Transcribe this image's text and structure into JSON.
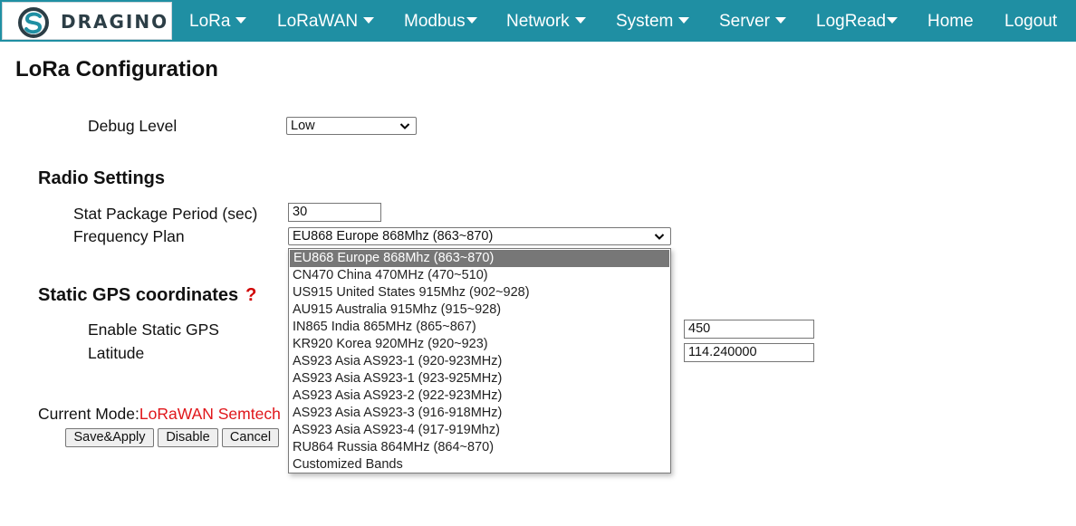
{
  "nav": {
    "logo_text": "DRAGINO",
    "items": [
      {
        "label": "LoRa",
        "has_caret": true
      },
      {
        "label": "LoRaWAN",
        "has_caret": true
      },
      {
        "label": "Modbus",
        "has_caret": true
      },
      {
        "label": "Network",
        "has_caret": true
      },
      {
        "label": "System",
        "has_caret": true
      },
      {
        "label": "Server",
        "has_caret": true
      },
      {
        "label": "LogRead",
        "has_caret": true
      },
      {
        "label": "Home",
        "has_caret": false
      },
      {
        "label": "Logout",
        "has_caret": false
      }
    ]
  },
  "page": {
    "title": "LoRa Configuration",
    "debug_level_label": "Debug Level",
    "debug_level_value": "Low",
    "radio_section": "Radio Settings",
    "stat_period_label": "Stat Package Period (sec)",
    "stat_period_value": "30",
    "freq_plan_label": "Frequency Plan",
    "freq_plan_value": "EU868 Europe 868Mhz (863~870)",
    "gps_section": "Static GPS coordinates",
    "gps_help": "?",
    "enable_gps_label": "Enable Static GPS",
    "latitude_label": "Latitude",
    "altitude_value": "450",
    "longitude_value": "114.240000",
    "mode_label": "Current Mode:",
    "mode_value": "LoRaWAN Semtech",
    "buttons": {
      "save": "Save&Apply",
      "disable": "Disable",
      "cancel": "Cancel"
    }
  },
  "dropdown": {
    "options": [
      "EU868 Europe 868Mhz (863~870)",
      "CN470 China 470MHz (470~510)",
      "US915 United States 915Mhz (902~928)",
      "AU915 Australia 915Mhz (915~928)",
      "IN865 India 865MHz (865~867)",
      "KR920 Korea 920MHz (920~923)",
      "AS923 Asia AS923-1 (920-923MHz)",
      "AS923 Asia AS923-1 (923-925MHz)",
      "AS923 Asia AS923-2 (922-923MHz)",
      "AS923 Asia AS923-3 (916-918MHz)",
      "AS923 Asia AS923-4 (917-919Mhz)",
      "RU864 Russia 864MHz (864~870)",
      "Customized Bands"
    ],
    "selected": "EU868 Europe 868Mhz (863~870)"
  },
  "colors": {
    "navbar": "#1f8fa3",
    "mode_value": "#e0161a",
    "help_icon": "#d00000",
    "selected_option": "#777777"
  }
}
